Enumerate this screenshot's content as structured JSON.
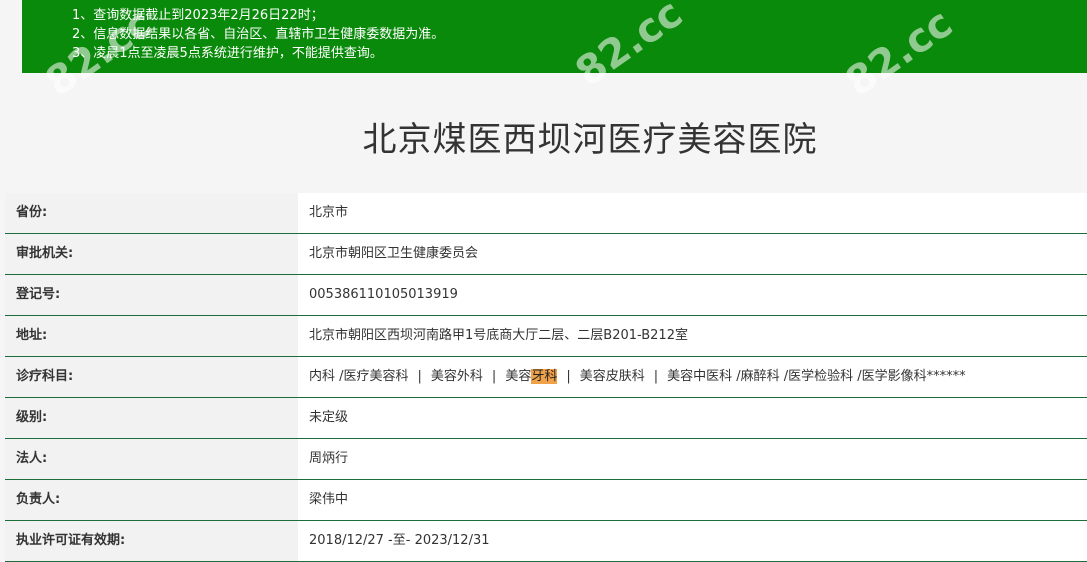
{
  "notice": {
    "lines": [
      "1、查询数据截止到2023年2月26日22时；",
      "2、信息数据结果以各省、自治区、直辖市卫生健康委数据为准。",
      "3、凌晨1点至凌晨5点系统进行维护，不能提供查询。"
    ]
  },
  "title": "北京煤医西坝河医疗美容医院",
  "rows": [
    {
      "label": "省份:",
      "value": "北京市"
    },
    {
      "label": "审批机关:",
      "value": "北京市朝阳区卫生健康委员会"
    },
    {
      "label": "登记号:",
      "value": "005386110105013919"
    },
    {
      "label": "地址:",
      "value": "北京市朝阳区西坝河南路甲1号底商大厅二层、二层B201-B212室"
    },
    {
      "label": "诊疗科目:",
      "value_parts": {
        "p1": "内科 /医疗美容科",
        "p2": "美容外科",
        "p3_pre": "美容",
        "p3_hl": "牙科",
        "p4": "美容皮肤科",
        "p5": "美容中医科 /麻醉科 /医学检验科 /医学影像科******"
      }
    },
    {
      "label": "级别:",
      "value": "未定级"
    },
    {
      "label": "法人:",
      "value": "周炳行"
    },
    {
      "label": "负责人:",
      "value": "梁伟中"
    },
    {
      "label": "执业许可证有效期:",
      "value": "2018/12/27 -至- 2023/12/31"
    }
  ],
  "separator": "|",
  "watermark": "82.cc"
}
